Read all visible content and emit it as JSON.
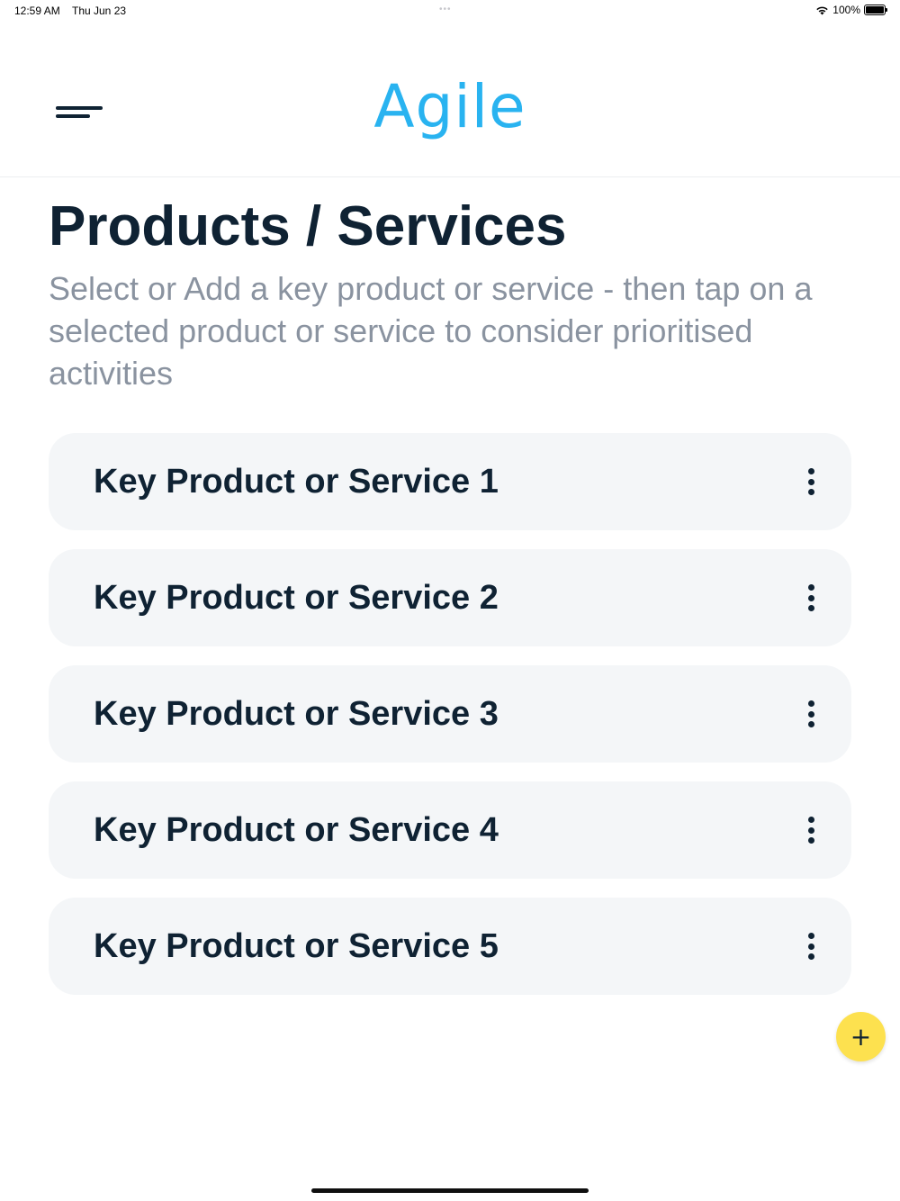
{
  "status_bar": {
    "time": "12:59 AM",
    "date": "Thu Jun 23",
    "battery": "100%",
    "dots": "•••"
  },
  "header": {
    "logo_text": "Agile",
    "menu_icon": "hamburger-menu-icon",
    "logo_color": "#29b3f0"
  },
  "page": {
    "title": "Products / Services",
    "subtitle": "Select or Add a key product or service - then tap on a selected product or service to consider prioritised activities"
  },
  "items": [
    {
      "label": "Key Product or Service 1"
    },
    {
      "label": "Key Product or Service 2"
    },
    {
      "label": "Key Product or Service 3"
    },
    {
      "label": "Key Product or Service 4"
    },
    {
      "label": "Key Product or Service 5"
    }
  ],
  "fab": {
    "label": "+",
    "color": "#fde14f"
  },
  "colors": {
    "text_primary": "#0f2233",
    "text_secondary": "#8a93a0",
    "card_bg": "#f4f6f8"
  }
}
